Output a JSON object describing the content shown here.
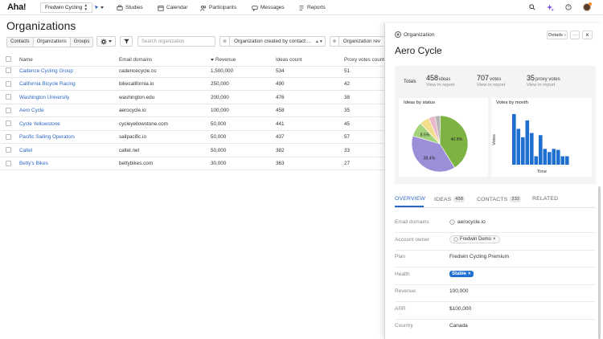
{
  "app": {
    "logo": "Aha!",
    "workspace": "Fredwin Cycling",
    "nav": [
      {
        "label": "Studies",
        "icon": "studies-icon"
      },
      {
        "label": "Calendar",
        "icon": "calendar-icon"
      },
      {
        "label": "Participants",
        "icon": "participants-icon"
      },
      {
        "label": "Messages",
        "icon": "messages-icon"
      },
      {
        "label": "Reports",
        "icon": "reports-icon"
      }
    ]
  },
  "page": {
    "title": "Organizations",
    "segments": [
      "Contacts",
      "Organizations",
      "Groups"
    ],
    "active_segment": "Organizations",
    "search_placeholder": "Search organization",
    "filters": [
      "Organization created by contact:...",
      "Organization rev"
    ]
  },
  "table": {
    "columns": [
      "Name",
      "Email domains",
      "Revenue",
      "Ideas count",
      "Proxy votes count"
    ],
    "sorted_column": "Revenue",
    "rows": [
      {
        "name": "Cadence Cycling Group",
        "domain": "cadencecycle.co",
        "revenue": "1,500,000",
        "ideas": "534",
        "proxy": "51"
      },
      {
        "name": "California Bicycle Racing",
        "domain": "bikecalifornia.io",
        "revenue": "250,000",
        "ideas": "490",
        "proxy": "42"
      },
      {
        "name": "Washington University",
        "domain": "washington.edu",
        "revenue": "200,000",
        "ideas": "476",
        "proxy": "38"
      },
      {
        "name": "Aero Cycle",
        "domain": "aerocycle.io",
        "revenue": "100,000",
        "ideas": "458",
        "proxy": "35"
      },
      {
        "name": "Cycle Yellowstone",
        "domain": "cycleyellowstone.com",
        "revenue": "50,000",
        "ideas": "441",
        "proxy": "45"
      },
      {
        "name": "Pacific Sailing Operators",
        "domain": "sailpacific.io",
        "revenue": "50,000",
        "ideas": "437",
        "proxy": "57"
      },
      {
        "name": "Caltel",
        "domain": "caltel.net",
        "revenue": "50,000",
        "ideas": "382",
        "proxy": "33"
      },
      {
        "name": "Betty's Bikes",
        "domain": "bettybikes.com",
        "revenue": "30,000",
        "ideas": "363",
        "proxy": "27"
      }
    ]
  },
  "panel": {
    "kind": "Organization",
    "details_label": "Details",
    "more_label": "···",
    "close_label": "×",
    "title": "Aero Cycle",
    "totals_label": "Totals",
    "totals": [
      {
        "num": "458",
        "unit": "ideas",
        "link": "View in report"
      },
      {
        "num": "707",
        "unit": "votes",
        "link": "View in report"
      },
      {
        "num": "35",
        "unit": "proxy votes",
        "link": "View in report"
      }
    ],
    "tabs": [
      {
        "label": "OVERVIEW",
        "count": ""
      },
      {
        "label": "IDEAS",
        "count": "458"
      },
      {
        "label": "CONTACTS",
        "count": "232"
      },
      {
        "label": "RELATED",
        "count": ""
      }
    ],
    "fields": [
      {
        "label": "Email domains",
        "value": "aerocycle.io"
      },
      {
        "label": "Account owner",
        "value": "Fredwin Demo"
      },
      {
        "label": "Plan",
        "value": "Fredwin Cycling Premium"
      },
      {
        "label": "Health",
        "value": "Stable"
      },
      {
        "label": "Revenue",
        "value": "100,000"
      },
      {
        "label": "ARR",
        "value": "$100,000"
      },
      {
        "label": "Country",
        "value": "Canada"
      }
    ]
  },
  "chart_data": [
    {
      "type": "pie",
      "title": "Ideas by status",
      "slices": [
        {
          "value": 40.8,
          "color": "#7cb342",
          "label": "40.8%"
        },
        {
          "value": 38.4,
          "color": "#9c8fd8",
          "label": "38.4%"
        },
        {
          "value": 8.5,
          "color": "#a4d47a",
          "label": "8.5%"
        },
        {
          "value": 5.5,
          "color": "#f3dd8c",
          "label": ""
        },
        {
          "value": 3.8,
          "color": "#e8b7c9",
          "label": ""
        },
        {
          "value": 3.0,
          "color": "#b5b5b5",
          "label": ""
        }
      ]
    },
    {
      "type": "bar",
      "title": "Votes by month",
      "xlabel": "Time",
      "ylabel": "Votes",
      "color": "#1f6fd1",
      "values": [
        48,
        34,
        26,
        42,
        30,
        8,
        28,
        15,
        12,
        15,
        14,
        8,
        8
      ]
    }
  ]
}
